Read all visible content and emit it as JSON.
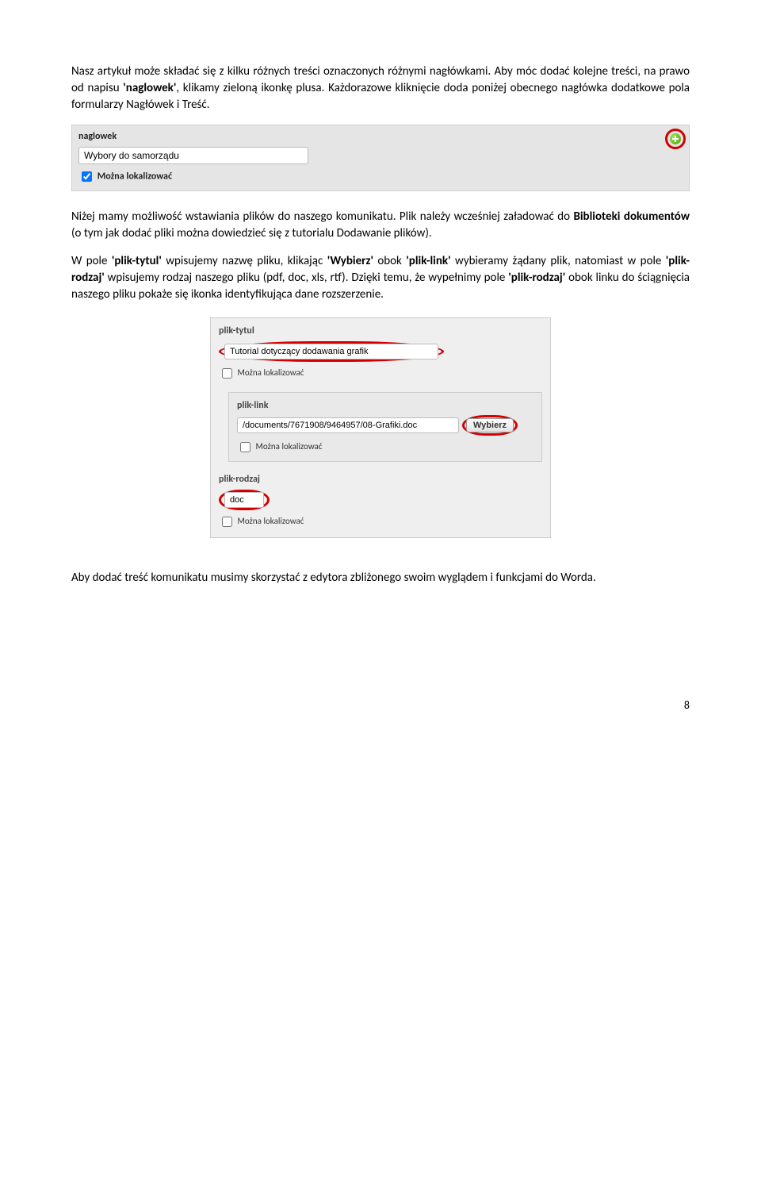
{
  "para1_a": "Nasz artykuł może składać się z kilku różnych treści oznaczonych różnymi nagłówkami. Aby móc dodać kolejne treści, na prawo od napisu ",
  "para1_b": "'naglowek'",
  "para1_c": ", klikamy zieloną ikonkę plusa. Każdorazowe kliknięcie doda poniżej obecnego nagłówka dodatkowe pola formularzy Nagłówek i Treść.",
  "shot1": {
    "label": "naglowek",
    "value": "Wybory do samorządu",
    "chk_label": "Można lokalizować"
  },
  "para2_a": "Niżej mamy możliwość wstawiania plików do naszego komunikatu. Plik należy wcześniej załadować do ",
  "para2_b": "Biblioteki dokumentów",
  "para2_c": " (o tym jak dodać pliki można dowiedzieć się z tutorialu Dodawanie plików).",
  "para3_a": "W pole ",
  "para3_b": "'plik-tytul'",
  "para3_c": " wpisujemy nazwę pliku, klikając ",
  "para3_d": "'Wybierz'",
  "para3_e": " obok ",
  "para3_f": "'plik-link'",
  "para3_g": " wybieramy żądany plik, natomiast w pole ",
  "para3_h": "'plik-rodzaj'",
  "para3_i": " wpisujemy rodzaj naszego pliku (pdf, doc, xls, rtf). Dzięki temu, że wypełnimy pole ",
  "para3_j": "'plik-rodzaj'",
  "para3_k": " obok linku do ściągnięcia naszego pliku pokaże się ikonka identyfikująca dane rozszerzenie.",
  "shot2": {
    "tytul_label": "plik-tytul",
    "tytul_value": "Tutorial dotyczący dodawania grafik",
    "chk_label": "Można lokalizować",
    "link_label": "plik-link",
    "link_value": "/documents/7671908/9464957/08-Grafiki.doc",
    "btn_label": "Wybierz",
    "rodzaj_label": "plik-rodzaj",
    "rodzaj_value": "doc"
  },
  "para4": "Aby dodać treść komunikatu musimy skorzystać z edytora zbliżonego swoim wyglądem i funkcjami do Worda.",
  "page_number": "8"
}
